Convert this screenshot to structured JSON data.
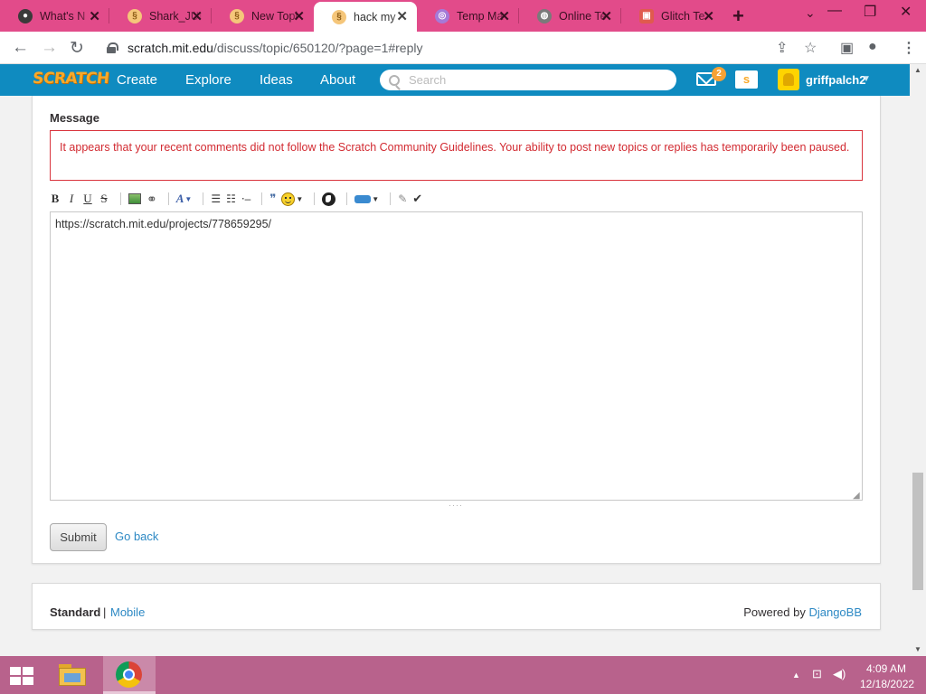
{
  "browser": {
    "tabs": [
      {
        "title": "What's N",
        "favicon": "github-icon",
        "color": "#3a3a3a"
      },
      {
        "title": "Shark_JUI",
        "favicon": "sand-icon",
        "color": "#f5c67a"
      },
      {
        "title": "New Topi",
        "favicon": "sand-icon",
        "color": "#f5c67a"
      },
      {
        "title": "hack my",
        "favicon": "sand-icon",
        "color": "#f5c67a"
      },
      {
        "title": "Temp Ma",
        "favicon": "temp-mail-icon",
        "color": "#a57ad8"
      },
      {
        "title": "Online Te",
        "favicon": "globe-icon",
        "color": "#7a7a7a"
      },
      {
        "title": "Glitch Te",
        "favicon": "glitch-icon",
        "color": "#e05a4e"
      }
    ],
    "active_tab_index": 3,
    "url_host": "scratch.mit.edu",
    "url_path": "/discuss/topic/650120/?page=1#reply"
  },
  "scratch_nav": {
    "logo": "SCRATCH",
    "links": [
      "Create",
      "Explore",
      "Ideas",
      "About"
    ],
    "search_placeholder": "Search",
    "message_count": "2",
    "mystuff_glyph": "s",
    "username": "griffpalch2"
  },
  "form": {
    "label": "Message",
    "warning": "It appears that your recent comments did not follow the Scratch Community Guidelines. Your ability to post new topics or replies has temporarily been paused.",
    "editor_value": "https://scratch.mit.edu/projects/778659295/",
    "toolbar_buttons": [
      "B",
      "I",
      "U",
      "S"
    ],
    "submit_label": "Submit",
    "go_back_label": "Go back"
  },
  "footer": {
    "standard": "Standard",
    "separator": "|",
    "mobile": "Mobile",
    "powered_prefix": "Powered by ",
    "powered_link": "DjangoBB"
  },
  "taskbar": {
    "time": "4:09 AM",
    "date": "12/18/2022"
  },
  "colors": {
    "tabstrip": "#e24b8a",
    "scratch_blue": "#0f8bc0",
    "warning_red": "#d22a31",
    "link_blue": "#2d89c4",
    "taskbar": "#b8628c"
  }
}
